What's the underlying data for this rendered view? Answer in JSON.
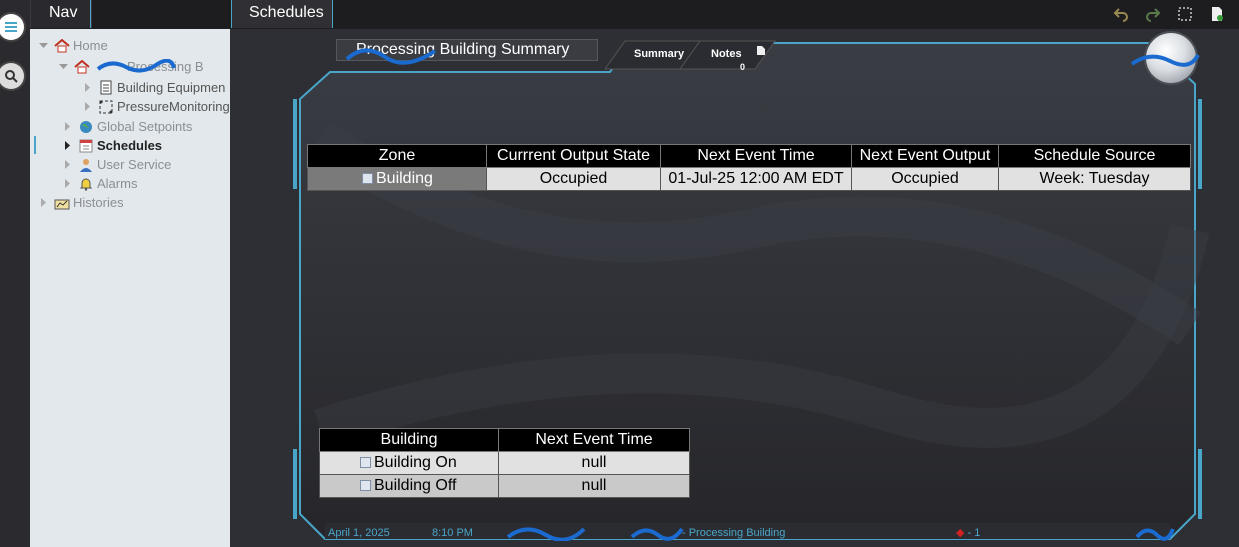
{
  "tabs": {
    "nav": "Nav",
    "schedules": "Schedules"
  },
  "toolbar": {
    "undo_icon": "undo-icon",
    "redo_icon": "redo-icon",
    "select_icon": "marquee-select-icon",
    "save_icon": "save-doc-icon"
  },
  "nav_tree": [
    {
      "label": "Home",
      "level": 0,
      "icon": "home-icon",
      "expanded": true
    },
    {
      "label": "Processing B",
      "level": 1,
      "icon": "home-icon",
      "expanded": true
    },
    {
      "label": "Building Equipmen",
      "level": 2,
      "icon": "document-icon",
      "expanded": false
    },
    {
      "label": "PressureMonitoring",
      "level": 2,
      "icon": "network-icon",
      "expanded": false
    },
    {
      "label": "Global Setpoints",
      "level": 1,
      "icon": "globe-icon",
      "expanded": false
    },
    {
      "label": "Schedules",
      "level": 1,
      "icon": "calendar-icon",
      "expanded": false,
      "selected": true
    },
    {
      "label": "User Service",
      "level": 1,
      "icon": "user-icon",
      "expanded": false
    },
    {
      "label": "Alarms",
      "level": 1,
      "icon": "bell-icon",
      "expanded": false
    },
    {
      "label": "Histories",
      "level": 0,
      "icon": "histories-icon",
      "expanded": false
    }
  ],
  "header": {
    "title": "Processing Building Summary",
    "summary_tab": "Summary",
    "notes_tab": "Notes",
    "notes_count": "0"
  },
  "summary_table": {
    "columns": [
      "Zone",
      "Currrent Output State",
      "Next Event Time",
      "Next Event Output",
      "Schedule Source"
    ],
    "rows": [
      [
        "Building",
        "Occupied",
        "01-Jul-25 12:00 AM EDT",
        "Occupied",
        "Week: Tuesday"
      ]
    ]
  },
  "events_table": {
    "columns": [
      "Building",
      "Next Event Time"
    ],
    "rows": [
      [
        "Building On",
        "null"
      ],
      [
        "Building Off",
        "null"
      ]
    ]
  },
  "status_bar": {
    "date": "April 1, 2025",
    "time": "8:10 PM",
    "location": "- Processing Building",
    "alarm_count": "1"
  },
  "colors": {
    "accent": "#4aa6c8",
    "panel": "#2e2e33",
    "nav_bg": "#e3e8ec",
    "alarm": "#d02020"
  }
}
